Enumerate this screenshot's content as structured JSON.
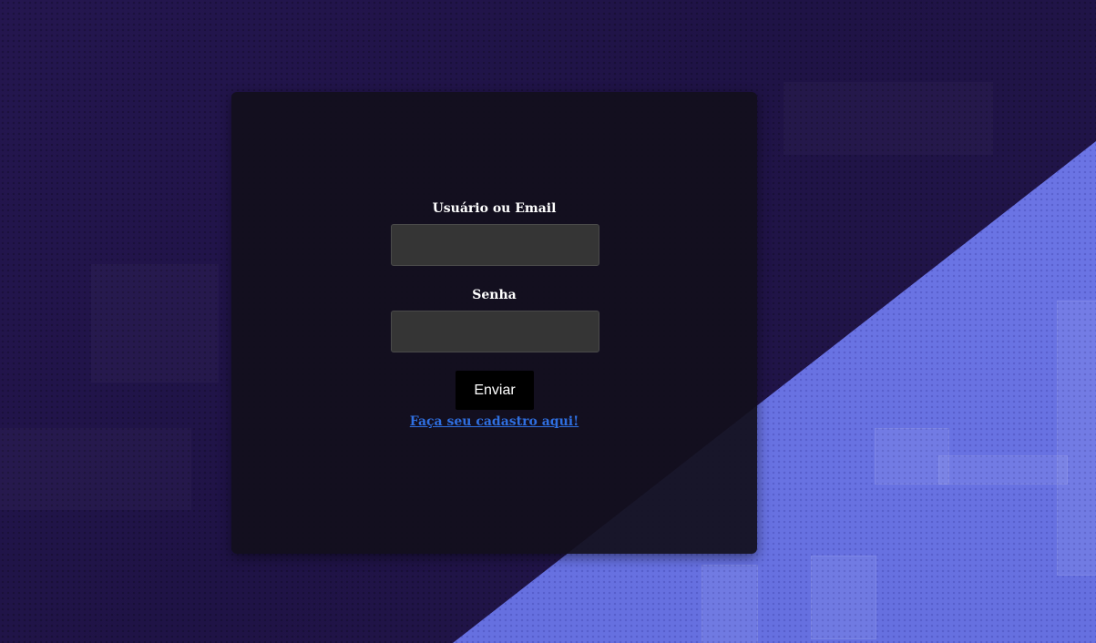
{
  "login_form": {
    "username_label": "Usuário ou Email",
    "username_value": "",
    "password_label": "Senha",
    "password_value": "",
    "submit_label": "Enviar",
    "register_link": "Faça seu cadastro aqui!"
  },
  "colors": {
    "background": "#221548",
    "diagonal_accent": "#6a73e4",
    "card": "#120f1c",
    "input": "#353535",
    "button": "#000000",
    "link": "#2f6fe0"
  }
}
